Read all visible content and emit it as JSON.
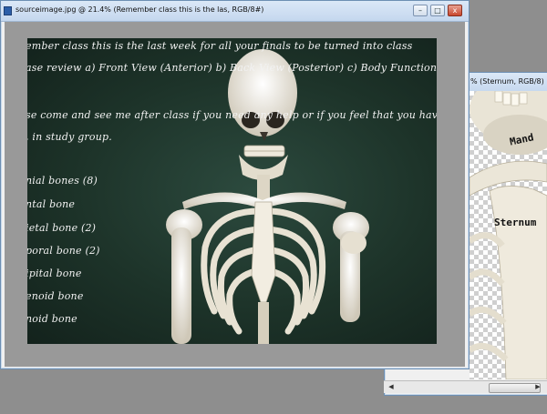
{
  "window_main": {
    "title": "sourceimage.jpg @ 21.4% (Remember class this is the las, RGB/8#)",
    "controls": [
      "–",
      "□",
      "x"
    ]
  },
  "window_secondary": {
    "title": "% (Sternum, RGB/8)"
  },
  "chalkboard": {
    "lines": [
      "ember class this is the last week for all your finals to be turned into class",
      "ase review a) Front View (Anterior) b) Back View (Posterior) c) Body Functions",
      "se come and see me after class if you need any help or if you feel that you have",
      ", in study group."
    ],
    "bones": [
      "nial bones (8)",
      "ntal bone",
      "ietal bone (2)",
      "poral bone (2)",
      "ipital bone",
      "enoid bone",
      "noid bone"
    ]
  },
  "labels": {
    "mandible": "Mand",
    "sternum": "Sternum"
  },
  "colors": {
    "board": "#1d3329",
    "canvas_bg": "#999999",
    "titlebar": "#c4d7ee"
  }
}
